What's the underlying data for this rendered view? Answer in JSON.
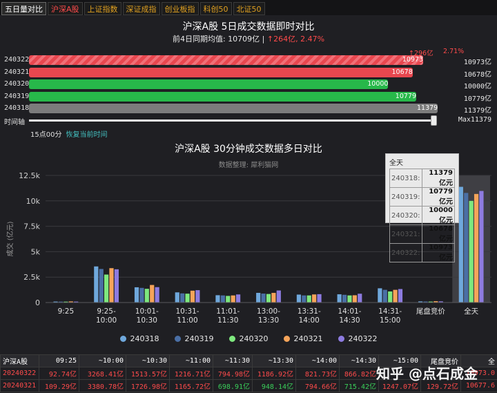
{
  "tabs": [
    {
      "label": "五日量对比",
      "style": "active"
    },
    {
      "label": "沪深A股",
      "style": "red"
    },
    {
      "label": "上证指数",
      "style": ""
    },
    {
      "label": "深证成指",
      "style": ""
    },
    {
      "label": "创业板指",
      "style": ""
    },
    {
      "label": "科创50",
      "style": ""
    },
    {
      "label": "北证50",
      "style": ""
    }
  ],
  "top": {
    "title": "沪深A股 5日成交数据即时对比",
    "avg_label": "前4日同期均值: 10709亿 | ",
    "avg_delta": "↑264亿, 2.47%",
    "diff_abs": "↑296亿",
    "diff_pct": "2.71%",
    "max_value": 11379,
    "colors": {
      "red": "#e8474f",
      "green": "#27b84a",
      "gray": "#7c7c7c"
    },
    "rows": [
      {
        "date": "240322",
        "value": 10973,
        "label": "10973",
        "right": "10973亿",
        "color": "red",
        "striped": true
      },
      {
        "date": "240321",
        "value": 10678,
        "label": "10678",
        "right": "10678亿",
        "color": "red",
        "striped": false
      },
      {
        "date": "240320",
        "value": 10000,
        "label": "10000",
        "right": "10000亿",
        "color": "green",
        "striped": false
      },
      {
        "date": "240319",
        "value": 10779,
        "label": "10779",
        "right": "10779亿",
        "color": "green",
        "striped": false
      },
      {
        "date": "240318",
        "value": 11379,
        "label": "11379",
        "right": "11379亿",
        "color": "gray",
        "striped": false
      }
    ],
    "timeline_label": "时间轴",
    "timeline_max": "Max11379",
    "time_now": "15点00分",
    "restore_link": "恢复当前时间"
  },
  "chart_data": {
    "type": "bar",
    "title": "沪深A股 30分钟成交数据多日对比",
    "subtitle": "数据整理: 犀利猫网",
    "ylabel": "成交 (亿元)",
    "ylim": [
      0,
      12500
    ],
    "yticks": [
      0,
      2500,
      5000,
      7500,
      10000,
      12500
    ],
    "ytick_labels": [
      "0",
      "2.5k",
      "5k",
      "7.5k",
      "10k",
      "12.5k"
    ],
    "categories": [
      "9:25",
      "9:25-\n10:00",
      "10:01-\n10:30",
      "10:31-\n11:00",
      "11:01-\n11:30",
      "13:00-\n13:30",
      "13:31-\n14:00",
      "14:01-\n14:30",
      "14:31-\n15:00",
      "尾盘竞价",
      "全天"
    ],
    "highlight_category": "全天",
    "series": [
      {
        "name": "240318",
        "color": "#6fa8dc",
        "values": [
          95,
          3550,
          1500,
          1000,
          720,
          950,
          780,
          810,
          1400,
          110,
          11379
        ]
      },
      {
        "name": "240319",
        "color": "#4a6fa5",
        "values": [
          90,
          3300,
          1440,
          900,
          700,
          880,
          700,
          760,
          1250,
          100,
          10779
        ]
      },
      {
        "name": "240320",
        "color": "#7ee87e",
        "values": [
          88,
          2750,
          1350,
          870,
          650,
          840,
          700,
          700,
          1090,
          95,
          10000
        ]
      },
      {
        "name": "240321",
        "color": "#f6a45a",
        "values": [
          109.29,
          3380.78,
          1726.98,
          1165.72,
          698.91,
          948.14,
          794.66,
          715.42,
          1247.07,
          129.72,
          10678
        ]
      },
      {
        "name": "240322",
        "color": "#8d7be0",
        "values": [
          92.74,
          3268.41,
          1513.57,
          1216.71,
          794.98,
          1186.92,
          821.73,
          866.82,
          1327.0,
          115.0,
          10973
        ]
      }
    ]
  },
  "tooltip": {
    "title": "全天",
    "rows": [
      {
        "date": "240318:",
        "value": "11379 亿元"
      },
      {
        "date": "240319:",
        "value": "10779 亿元"
      },
      {
        "date": "240320:",
        "value": "10000 亿元"
      },
      {
        "date": "240321:",
        "value": "10678 亿元"
      },
      {
        "date": "240322:",
        "value": "10973 亿元"
      }
    ]
  },
  "summary_table": {
    "headers": [
      "沪深A股",
      "09:25",
      "~10:00",
      "~10:30",
      "~11:00",
      "~11:30",
      "~13:30",
      "~14:00",
      "~14:30",
      "~15:00",
      "尾盘竞价",
      "全"
    ],
    "rows": [
      {
        "cells": [
          "20240322",
          "92.74亿",
          "3268.41亿",
          "1513.57亿",
          "1216.71亿",
          "794.98亿",
          "1186.92亿",
          "821.73亿",
          "866.82亿",
          "",
          "",
          "10973.0"
        ],
        "green": []
      },
      {
        "cells": [
          "20240321",
          "109.29亿",
          "3380.78亿",
          "1726.98亿",
          "1165.72亿",
          "698.91亿",
          "948.14亿",
          "794.66亿",
          "715.42亿",
          "1247.07亿",
          "129.72亿",
          "10677.6"
        ],
        "green": [
          5,
          6,
          8
        ]
      }
    ]
  },
  "watermark": "知乎 @点石成金"
}
